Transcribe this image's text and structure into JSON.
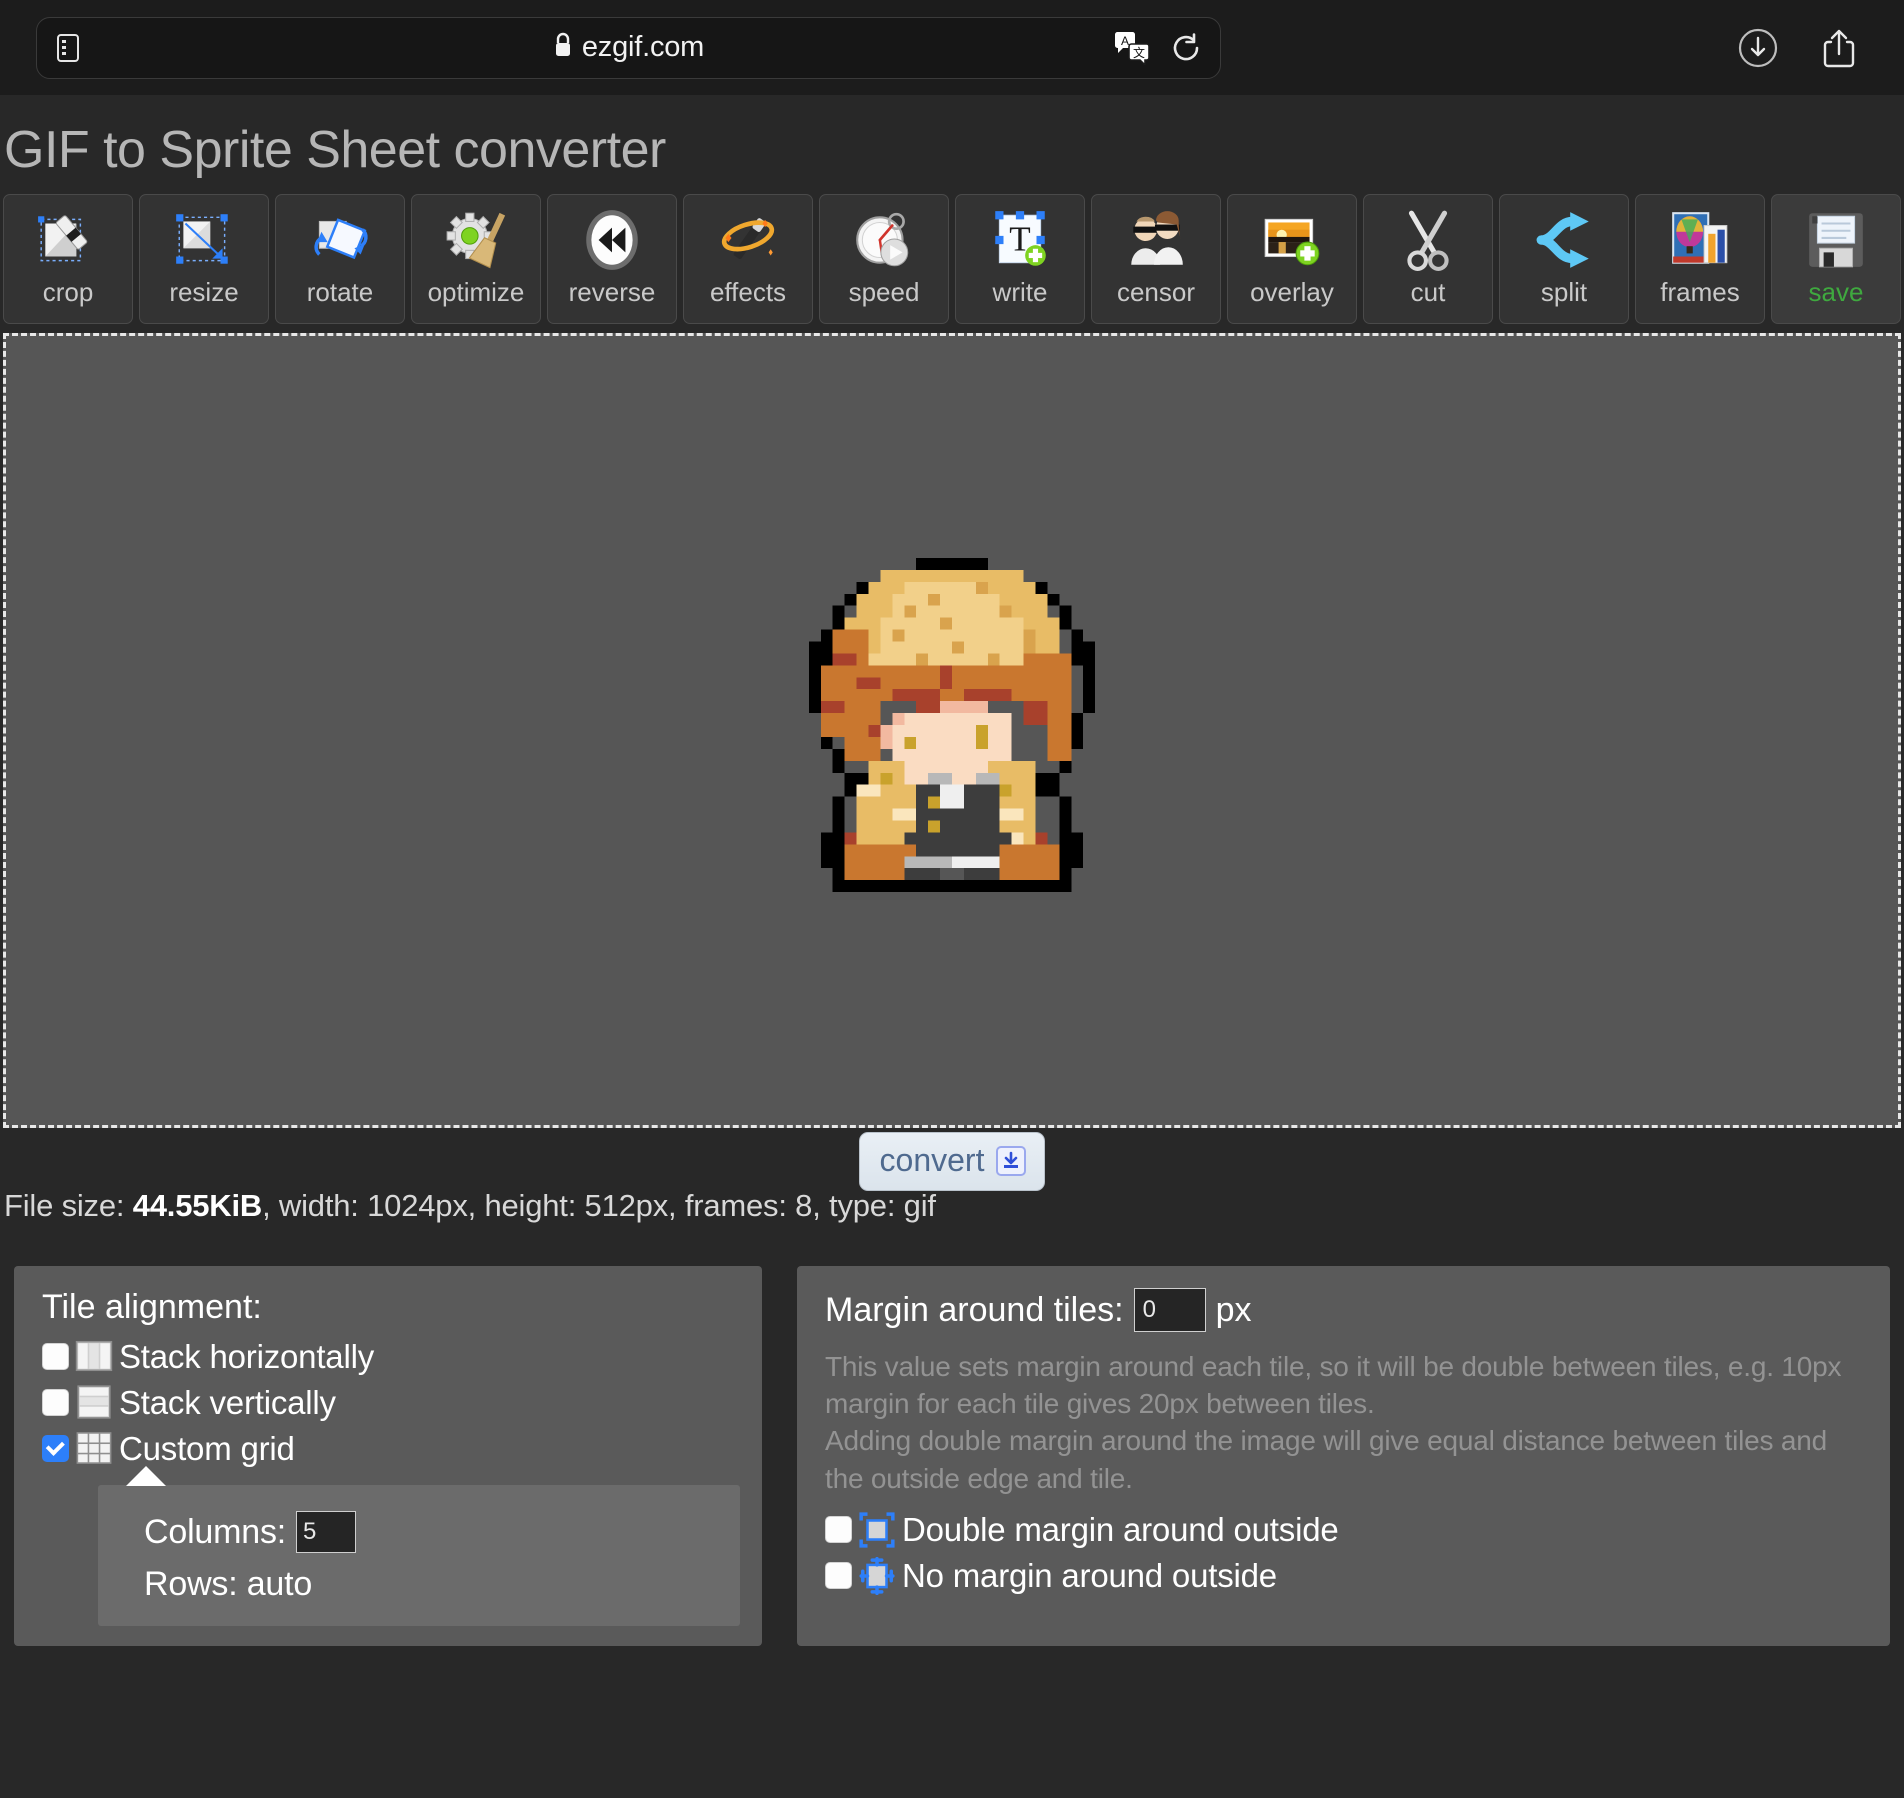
{
  "browser": {
    "url": "ezgif.com",
    "lock_icon": "lock-icon",
    "reader_icon": "reader-view-icon",
    "translate_icon": "translate-icon",
    "reload_icon": "reload-icon",
    "download_icon": "downloads-icon",
    "share_icon": "share-icon"
  },
  "page": {
    "title": "GIF to Sprite Sheet converter"
  },
  "toolbar": {
    "items": [
      {
        "label": "crop",
        "icon": "crop-icon"
      },
      {
        "label": "resize",
        "icon": "resize-icon"
      },
      {
        "label": "rotate",
        "icon": "rotate-icon"
      },
      {
        "label": "optimize",
        "icon": "optimize-icon"
      },
      {
        "label": "reverse",
        "icon": "reverse-icon"
      },
      {
        "label": "effects",
        "icon": "effects-icon"
      },
      {
        "label": "speed",
        "icon": "speed-icon"
      },
      {
        "label": "write",
        "icon": "write-icon"
      },
      {
        "label": "censor",
        "icon": "censor-icon"
      },
      {
        "label": "overlay",
        "icon": "overlay-icon"
      },
      {
        "label": "cut",
        "icon": "cut-icon"
      },
      {
        "label": "split",
        "icon": "split-icon"
      },
      {
        "label": "frames",
        "icon": "frames-icon"
      },
      {
        "label": "save",
        "icon": "save-icon",
        "active": true
      }
    ],
    "save_color": "#3fa93f"
  },
  "preview": {
    "alt": "pixel-art character sprite"
  },
  "convert": {
    "label": "convert",
    "icon": "download-badge-icon"
  },
  "fileinfo": {
    "prefix": "File size: ",
    "size": "44.55KiB",
    "rest": ", width: 1024px, height: 512px, frames: 8, type: gif"
  },
  "tile_panel": {
    "title": "Tile alignment:",
    "options": [
      {
        "label": "Stack horizontally",
        "checked": false,
        "icon": "stack-horizontal-icon"
      },
      {
        "label": "Stack vertically",
        "checked": false,
        "icon": "stack-vertical-icon"
      },
      {
        "label": "Custom grid",
        "checked": true,
        "icon": "custom-grid-icon"
      }
    ],
    "grid": {
      "columns_label": "Columns:",
      "columns_value": "5",
      "rows_label": "Rows: auto"
    }
  },
  "margin_panel": {
    "title": "Margin around tiles:",
    "value": "0",
    "unit": "px",
    "help": [
      "This value sets margin around each tile, so it will be double between tiles, e.g. 10px margin for each tile gives 20px between tiles.",
      "Adding double margin around the image will give equal distance between tiles and the outside edge and tile."
    ],
    "options": [
      {
        "label": "Double margin around outside",
        "checked": false,
        "icon": "double-margin-icon"
      },
      {
        "label": "No margin around outside",
        "checked": false,
        "icon": "no-margin-icon"
      }
    ]
  },
  "colors": {
    "page_bg": "#282828",
    "chrome_bg": "#1c1c1c",
    "canvas_bg": "#565656",
    "panel_bg": "#5a5a5a",
    "accent_blue": "#2d7ff9",
    "save_green": "#3fa93f"
  }
}
